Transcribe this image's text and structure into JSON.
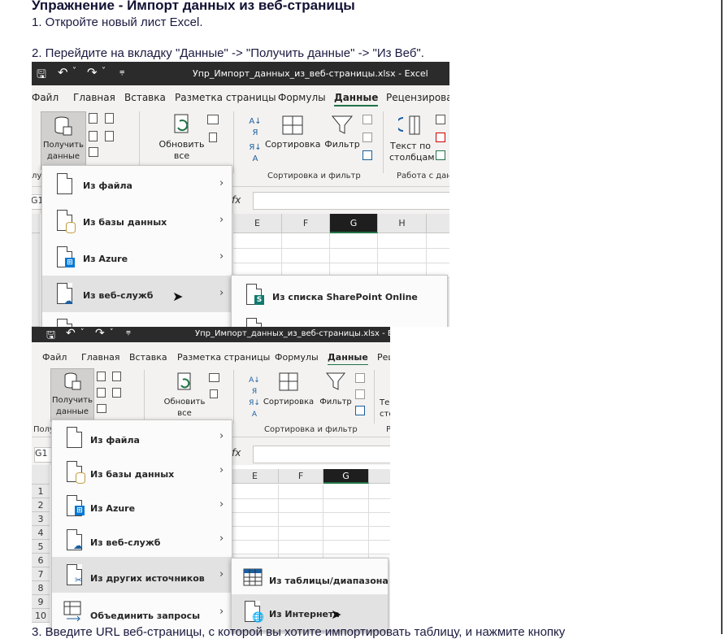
{
  "doc": {
    "title": "Упражнение - Импорт данных из веб-страницы",
    "step1": "1. Откройте новый лист Excel.",
    "step2": "2. Перейдите на вкладку \"Данные\" -> \"Получить данные\" -> \"Из Веб\".",
    "step3": "3. Введите URL веб-страницы, с которой вы хотите импортировать таблицу, и нажмите кнопку"
  },
  "shot1": {
    "window_title": "Упр_Импорт_данных_из_веб-страницы.xlsx  -  Excel",
    "tabs": [
      "Файл",
      "Главная",
      "Вставка",
      "Разметка страницы",
      "Формулы",
      "Данные",
      "Рецензирован"
    ],
    "ribbon": {
      "get_data": "Получить\nданные",
      "refresh": "Обновить\nвсе",
      "sort": "Сортировка",
      "filter": "Фильтр",
      "text_to_cols": "Текст по\nстолбцам",
      "group_sort": "Сортировка и фильтр",
      "group_tools": "Работа с дан",
      "group_get": "лу"
    },
    "namebox": "G1",
    "fx": "fx",
    "columns": [
      "E",
      "F",
      "G",
      "H"
    ],
    "menu": [
      "Из файла",
      "Из базы данных",
      "Из Azure",
      "Из веб-служб"
    ],
    "submenu": [
      "Из списка SharePoint Online"
    ]
  },
  "shot2": {
    "window_title": "Упр_Импорт_данных_из_веб-страницы.xlsx  -  Excel",
    "tabs": [
      "Файл",
      "Главная",
      "Вставка",
      "Разметка страницы",
      "Формулы",
      "Данные",
      "Рец"
    ],
    "ribbon": {
      "get_data": "Получить\nданные",
      "refresh": "Обновить\nвсе",
      "sort": "Сортировка",
      "filter": "Фильтр",
      "text_to_cols": "Те\nсто",
      "group_sort": "Сортировка и фильтр",
      "group_get": "Полу",
      "group_r": "Р"
    },
    "namebox": "G1",
    "fx": "fx",
    "columns": [
      "E",
      "F",
      "G"
    ],
    "rows": [
      "1",
      "2",
      "3",
      "4",
      "5",
      "6",
      "7",
      "8",
      "9",
      "10"
    ],
    "menu": [
      "Из файла",
      "Из базы данных",
      "Из Azure",
      "Из веб-служб",
      "Из других источников",
      "Объединить запросы"
    ],
    "submenu": [
      "Из таблицы/диапазона",
      "Из Интернета"
    ]
  },
  "colors": {
    "accent": "#217346",
    "titlebar": "#2b2b2b",
    "ribbon": "#f3f2f1",
    "highlight": "#e2e2e2"
  },
  "icons": [
    "save-icon",
    "undo-icon",
    "redo-icon",
    "customize-icon",
    "document-icon",
    "database-icon",
    "windows-icon",
    "cloud-icon",
    "sharepoint-icon",
    "table-icon",
    "globe-icon",
    "combine-icon",
    "filter-icon",
    "cursor-icon"
  ]
}
